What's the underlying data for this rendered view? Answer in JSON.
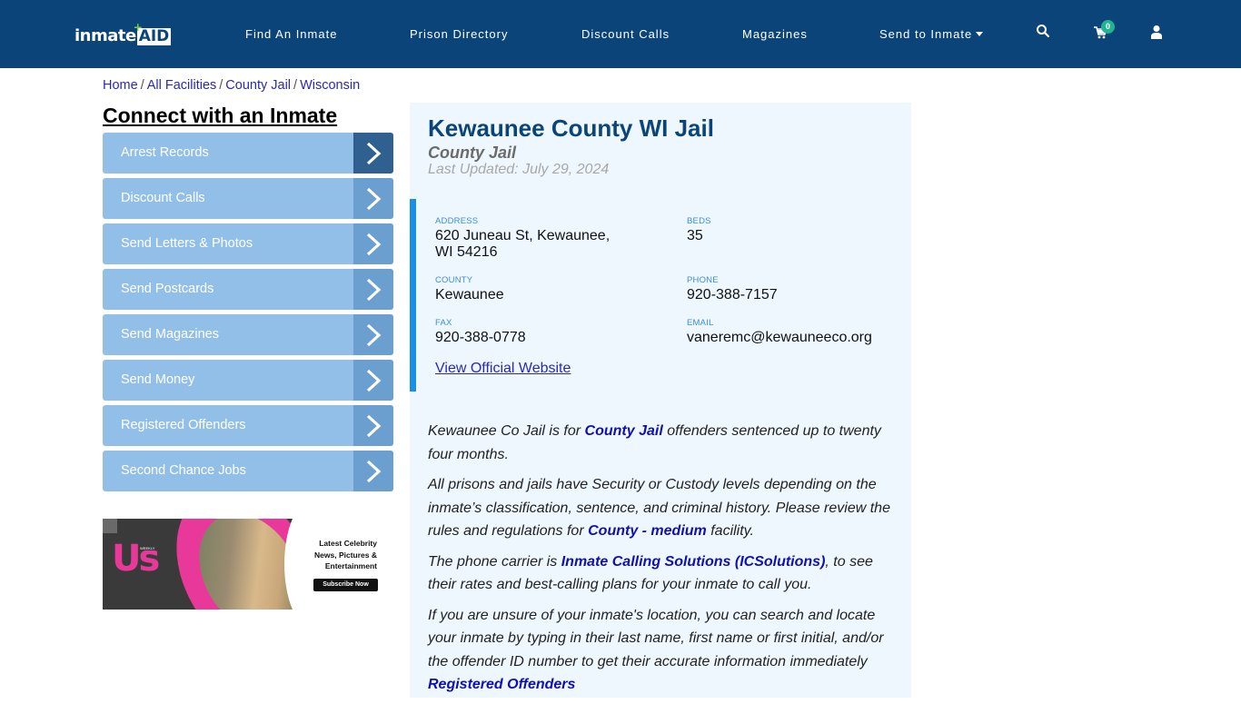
{
  "header": {
    "logo": {
      "text_main": "inmate",
      "text_accent": "AID",
      "plus": "+"
    },
    "nav": [
      {
        "label": "Find An Inmate"
      },
      {
        "label": "Prison Directory"
      },
      {
        "label": "Discount Calls"
      },
      {
        "label": "Magazines"
      },
      {
        "label": "Send to Inmate",
        "has_dropdown": true
      }
    ],
    "icons": {
      "search": "search-icon",
      "cart": "cart-icon",
      "account": "user-icon"
    },
    "cart_count": "0",
    "colors": {
      "background": "#0b4479",
      "badge": "#1fb58f"
    }
  },
  "breadcrumb": [
    {
      "label": "Home"
    },
    {
      "label": "All Facilities"
    },
    {
      "label": "County Jail"
    },
    {
      "label": "Wisconsin"
    }
  ],
  "sidebar": {
    "title": "Connect with an Inmate",
    "items": [
      {
        "label": "Arrest Records",
        "active": true
      },
      {
        "label": "Discount Calls"
      },
      {
        "label": "Send Letters & Photos"
      },
      {
        "label": "Send Postcards"
      },
      {
        "label": "Send Magazines"
      },
      {
        "label": "Send Money"
      },
      {
        "label": "Registered Offenders"
      },
      {
        "label": "Second Chance Jobs"
      }
    ],
    "ad": {
      "brand": "Us",
      "brand_tag": "WEEKLY",
      "headline_lines": [
        "Latest Celebrity",
        "News, Pictures &",
        "Entertainment"
      ],
      "cta": "Subscribe Now"
    }
  },
  "facility": {
    "name": "Kewaunee County WI Jail",
    "type": "County Jail",
    "last_updated": "Last Updated: July 29, 2024",
    "fields": {
      "address": {
        "label": "ADDRESS",
        "line1": "620 Juneau St, Kewaunee,",
        "line2": "WI 54216"
      },
      "beds": {
        "label": "BEDS",
        "value": "35"
      },
      "county": {
        "label": "COUNTY",
        "value": "Kewaunee"
      },
      "phone": {
        "label": "PHONE",
        "value": "920-388-7157"
      },
      "fax": {
        "label": "FAX",
        "value": "920-388-0778"
      },
      "email": {
        "label": "EMAIL",
        "value": "vaneremc@kewauneeco.org"
      }
    },
    "website_link": "View Official Website",
    "description": {
      "p1": {
        "before": "Kewaunee Co Jail is for ",
        "link": "County Jail",
        "after": " offenders sentenced up to twenty four months."
      },
      "p2": {
        "before": "All prisons and jails have Security or Custody levels depending on the inmate’s classification, sentence, and criminal history. Please review the rules and regulations for ",
        "link": "County - medium",
        "after": " facility."
      },
      "p3": {
        "before": "The phone carrier is ",
        "link": "Inmate Calling Solutions (ICSolutions)",
        "after": ", to see their rates and best-calling plans for your inmate to call you."
      },
      "p4": {
        "before": "If you are unsure of your inmate's location, you can search and locate your inmate by typing in their last name, first name or first initial, and/or the offender ID number to get their accurate information immediately ",
        "link": "Registered Offenders"
      }
    }
  }
}
